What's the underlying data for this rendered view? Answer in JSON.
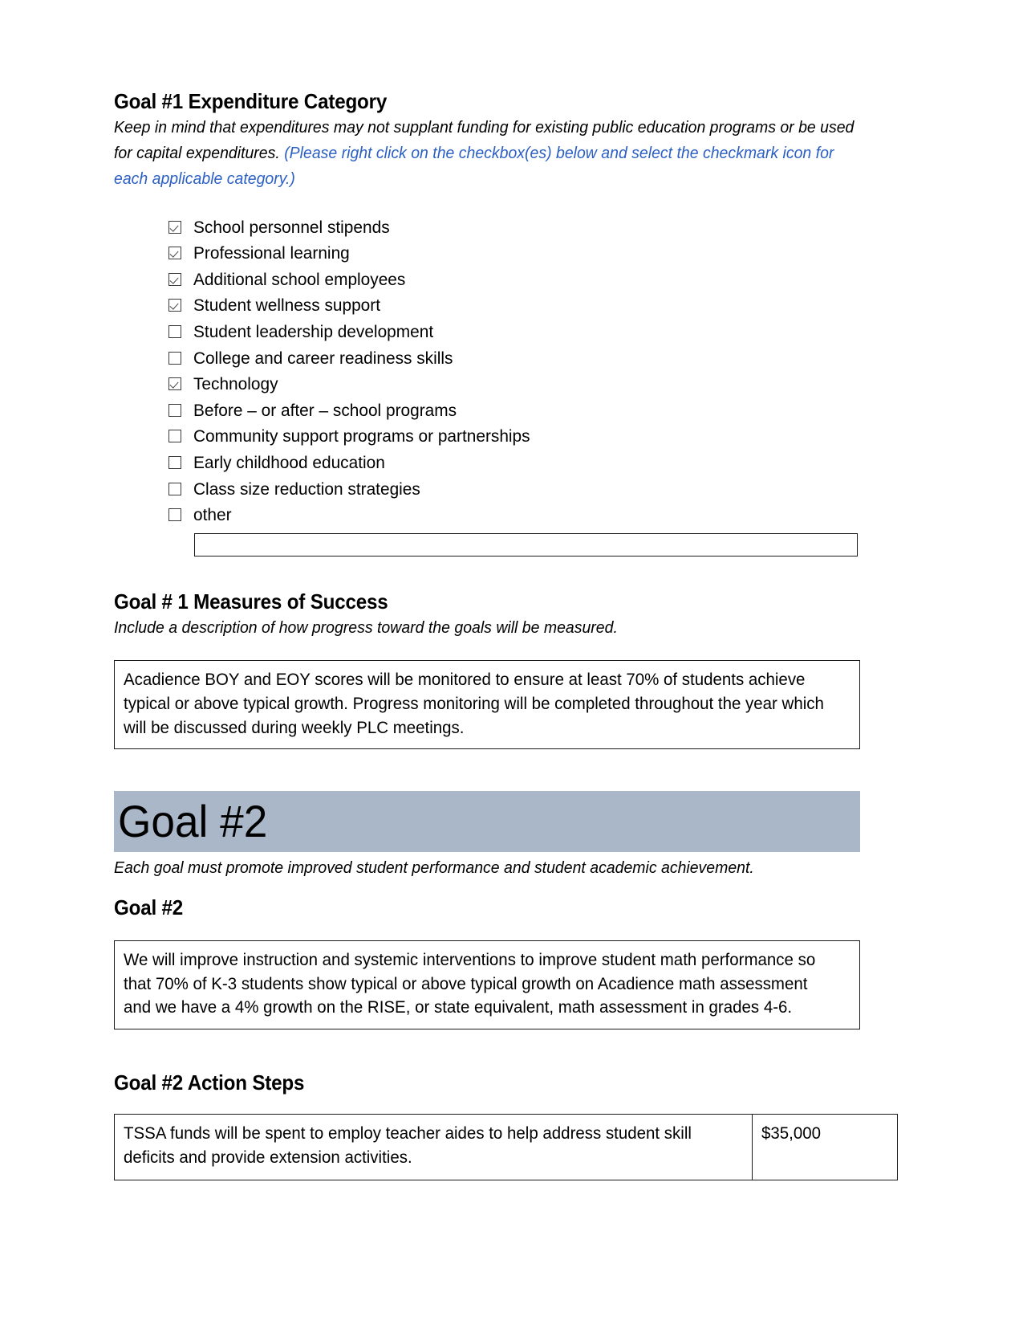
{
  "goal1": {
    "expenditure_heading": "Goal #1 Expenditure Category",
    "instruction_part1": "Keep in mind that expenditures may not supplant funding for existing public education programs or be used for capital expenditures. ",
    "instruction_part2": "(Please right click on the checkbox(es) below and select the checkmark icon for each applicable category.)",
    "instruction_blue_color": "#2b5fc4",
    "categories": [
      {
        "label": "School personnel stipends",
        "checked": true
      },
      {
        "label": "Professional learning",
        "checked": true
      },
      {
        "label": "Additional school employees",
        "checked": true
      },
      {
        "label": "Student wellness support",
        "checked": true
      },
      {
        "label": "Student leadership development",
        "checked": false
      },
      {
        "label": "College and career readiness skills",
        "checked": false
      },
      {
        "label": "Technology",
        "checked": true
      },
      {
        "label": "Before – or after – school programs",
        "checked": false
      },
      {
        "label": "Community support programs or partnerships",
        "checked": false
      },
      {
        "label": "Early childhood education",
        "checked": false
      },
      {
        "label": "Class size reduction strategies",
        "checked": false
      },
      {
        "label": "other",
        "checked": false
      }
    ],
    "other_input_value": "",
    "measures_heading": "Goal # 1 Measures of Success",
    "measures_instruction": "Include a description of how progress toward the goals will be measured.",
    "measures_text": "Acadience BOY and EOY scores will be monitored to ensure at least 70% of students achieve typical or above typical growth. Progress monitoring will be completed throughout the year which will be discussed during weekly PLC meetings."
  },
  "goal2": {
    "banner_title": "Goal #2",
    "banner_color": "#aab7c8",
    "banner_note": "Each goal must promote improved student performance and student academic achievement.",
    "goal_heading": "Goal #2",
    "goal_text": "We will improve instruction and systemic interventions to improve student math performance so that 70% of K-3 students show typical or above typical growth on Acadience math assessment and we have a 4% growth on the RISE, or state equivalent, math assessment in grades 4-6.",
    "action_steps_heading": "Goal #2 Action Steps",
    "action_steps": [
      {
        "description": "TSSA funds will be spent to employ teacher aides to help address student skill deficits and provide extension activities.",
        "amount": "$35,000"
      }
    ]
  }
}
